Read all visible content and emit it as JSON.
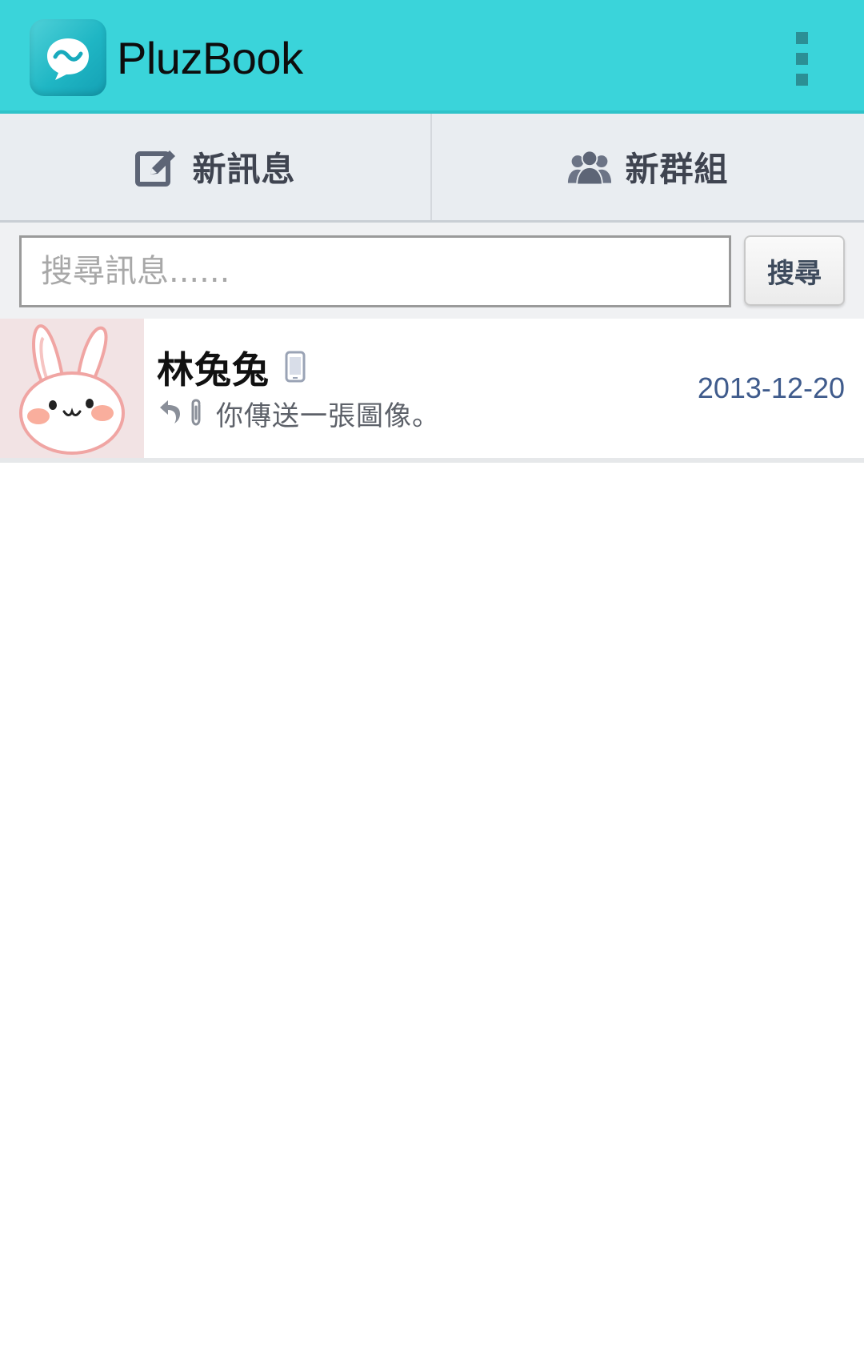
{
  "app_bar": {
    "title": "PluzBook",
    "logo_icon": "chat-bubble-logo-icon",
    "menu_icon": "overflow-menu-icon",
    "background": "#3ad4da"
  },
  "actions": [
    {
      "label": "新訊息",
      "icon": "compose-icon"
    },
    {
      "label": "新群組",
      "icon": "group-icon"
    }
  ],
  "search": {
    "placeholder": "搜尋訊息......",
    "value": "",
    "button_label": "搜尋"
  },
  "conversations": [
    {
      "name": "林兔兔",
      "device_icon": "mobile-phone-icon",
      "status_icons": [
        "reply-icon",
        "attachment-icon"
      ],
      "preview": "你傳送一張圖像。",
      "date": "2013-12-20",
      "avatar": "bunny-avatar"
    }
  ],
  "colors": {
    "accent": "#3ad4da",
    "date_text": "#3f5b8c",
    "action_text": "#3f4450"
  }
}
